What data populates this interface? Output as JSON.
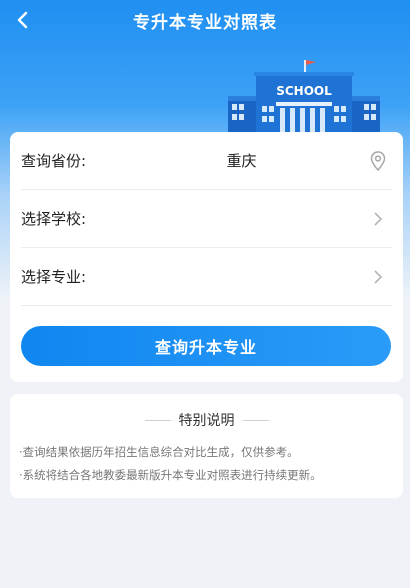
{
  "header": {
    "title": "专升本专业对照表",
    "back_icon": "chevron-left-icon"
  },
  "banner": {
    "school_sign": "SCHOOL",
    "flag_color": "#e85b4a"
  },
  "form": {
    "province": {
      "label": "查询省份:",
      "value": "重庆",
      "icon": "location-pin-icon"
    },
    "school": {
      "label": "选择学校:",
      "value": "",
      "icon": "chevron-right-icon"
    },
    "major": {
      "label": "选择专业:",
      "value": "",
      "icon": "chevron-right-icon"
    },
    "submit_label": "查询升本专业"
  },
  "notes": {
    "title": "特别说明",
    "items": [
      "·查询结果依据历年招生信息综合对比生成，仅供参考。",
      "·系统将结合各地教委最新版升本专业对照表进行持续更新。"
    ]
  },
  "colors": {
    "primary": "#1a8ff2",
    "background": "#eff3f8"
  }
}
